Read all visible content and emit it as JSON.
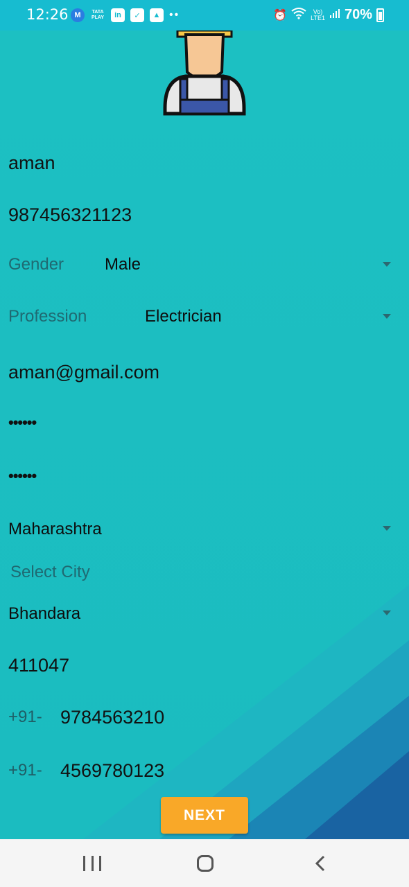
{
  "status_bar": {
    "time": "12:26",
    "mini_text": "TATA PLAY",
    "battery_percent": "70%"
  },
  "form": {
    "name": "aman",
    "mobile": "987456321123",
    "gender": {
      "label": "Gender",
      "value": "Male"
    },
    "profession": {
      "label": "Profession",
      "value": "Electrician"
    },
    "email": "aman@gmail.com",
    "password_mask": "••••••",
    "confirm_password_mask": "••••••",
    "state": "Maharashtra",
    "city_label": "Select City",
    "city": "Bhandara",
    "pincode": "411047",
    "phone1": {
      "prefix": "+91-",
      "number": "9784563210"
    },
    "phone2": {
      "prefix": "+91-",
      "number": "4569780123"
    }
  },
  "next_button": "NEXT",
  "colors": {
    "background": "#1bbfc1",
    "status_bar": "#17bcd0",
    "button": "#f9a828"
  },
  "icons": [
    "worker-avatar-icon",
    "dropdown-caret-icon",
    "recent-apps-icon",
    "home-icon",
    "back-icon"
  ]
}
